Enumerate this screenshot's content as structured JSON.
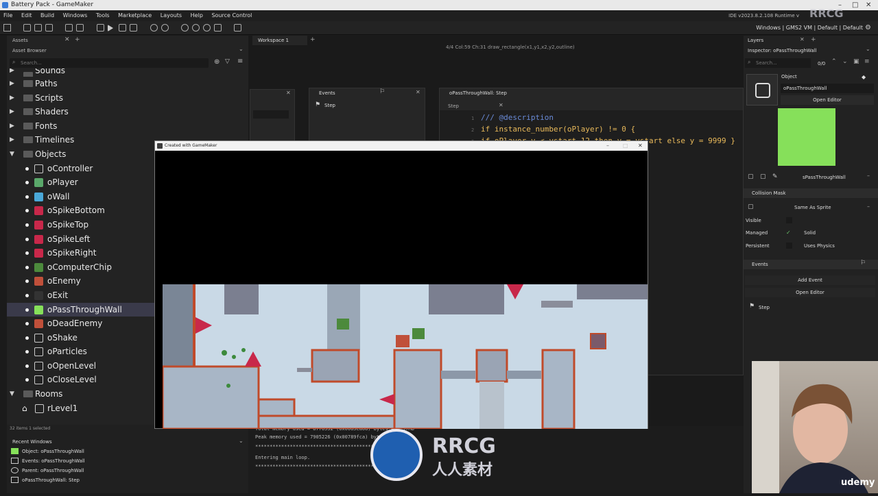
{
  "window": {
    "title": "Battery Pack - GameMaker"
  },
  "menu": [
    "File",
    "Edit",
    "Build",
    "Windows",
    "Tools",
    "Marketplace",
    "Layouts",
    "Help",
    "Source Control"
  ],
  "ide_version": "IDE v2023.8.2.108  Runtime v",
  "target_config": "Windows | GMS2 VM | Default | Default",
  "assets": {
    "tab_label": "Assets",
    "browser_title": "Asset Browser",
    "search_placeholder": "Search...",
    "tree": [
      {
        "label": "Sounds",
        "type": "folder"
      },
      {
        "label": "Paths",
        "type": "folder"
      },
      {
        "label": "Scripts",
        "type": "folder"
      },
      {
        "label": "Shaders",
        "type": "folder"
      },
      {
        "label": "Fonts",
        "type": "folder"
      },
      {
        "label": "Timelines",
        "type": "folder"
      },
      {
        "label": "Objects",
        "type": "folder-open"
      },
      {
        "label": "oController",
        "type": "object",
        "icon": "blank-sprite-icon"
      },
      {
        "label": "oPlayer",
        "type": "object",
        "icon": "player-sprite-icon"
      },
      {
        "label": "oWall",
        "type": "object",
        "icon": "wall-sprite-icon"
      },
      {
        "label": "oSpikeBottom",
        "type": "object",
        "icon": "spike-sprite-icon"
      },
      {
        "label": "oSpikeTop",
        "type": "object",
        "icon": "spike-sprite-icon"
      },
      {
        "label": "oSpikeLeft",
        "type": "object",
        "icon": "spike-sprite-icon"
      },
      {
        "label": "oSpikeRight",
        "type": "object",
        "icon": "spike-sprite-icon"
      },
      {
        "label": "oComputerChip",
        "type": "object",
        "icon": "chip-sprite-icon"
      },
      {
        "label": "oEnemy",
        "type": "object",
        "icon": "enemy-sprite-icon"
      },
      {
        "label": "oExit",
        "type": "object",
        "icon": "exit-sprite-icon"
      },
      {
        "label": "oPassThroughWall",
        "type": "object",
        "icon": "passthrough-sprite-icon",
        "selected": true
      },
      {
        "label": "oDeadEnemy",
        "type": "object",
        "icon": "enemy-sprite-icon"
      },
      {
        "label": "oShake",
        "type": "object",
        "icon": "blank-sprite-icon"
      },
      {
        "label": "oParticles",
        "type": "object",
        "icon": "blank-sprite-icon"
      },
      {
        "label": "oOpenLevel",
        "type": "object",
        "icon": "blank-sprite-icon"
      },
      {
        "label": "oCloseLevel",
        "type": "object",
        "icon": "blank-sprite-icon"
      },
      {
        "label": "Rooms",
        "type": "folder-open"
      },
      {
        "label": "rLevel1",
        "type": "room"
      }
    ],
    "status": "32 items   1 selected"
  },
  "recent_windows": {
    "title": "Recent Windows",
    "items": [
      "Object: oPassThroughWall",
      "Events: oPassThroughWall",
      "Parent: oPassThroughWall",
      "oPassThroughWall: Step"
    ]
  },
  "workspace": {
    "tab": "Workspace 1",
    "status_line": "4/4 Col:59 Ch:31   draw_rectangle(x1,y1,x2,y2,outline)",
    "events_title": "Events",
    "events_item": "Step",
    "step_title": "oPassThroughWall: Step",
    "step_tab": "Step",
    "code": [
      {
        "n": "1",
        "text": "/// @description"
      },
      {
        "n": "2",
        "text": "if instance_number(oPlayer) != 0 {"
      },
      {
        "n": "3",
        "text": "if oPlayer.y < ystart-12 then y = ystart else y = 9999 }"
      }
    ]
  },
  "game_window": {
    "title": "Created with GameMaker"
  },
  "output": [
    "Total memory used = 8776552 (0x0085ea68) bytes = 8.37MB",
    "Peak memory used = 7905226 (0x00789fca) bytes = 7.54MB",
    "**********************************************",
    "Entering main loop.",
    "**********************************************"
  ],
  "inspector": {
    "layers_tab": "Layers",
    "title": "Inspector: oPassThroughWall",
    "search_placeholder": "Search...",
    "count": "0/0",
    "object_label": "Object",
    "object_name": "oPassThroughWall",
    "open_editor": "Open Editor",
    "sprite_name": "sPassThroughWall",
    "sprite_color": "#86e05a",
    "collision_mask": "Collision Mask",
    "mask_value": "Same As Sprite",
    "visible": "Visible",
    "managed": "Managed",
    "solid": "Solid",
    "persistent": "Persistent",
    "uses_physics": "Uses Physics",
    "events": "Events",
    "add_event": "Add Event",
    "open_editor2": "Open Editor",
    "event_step": "Step"
  },
  "watermarks": {
    "rrcg": "RRCG",
    "cn": "人人素材",
    "udemy": "udemy"
  }
}
